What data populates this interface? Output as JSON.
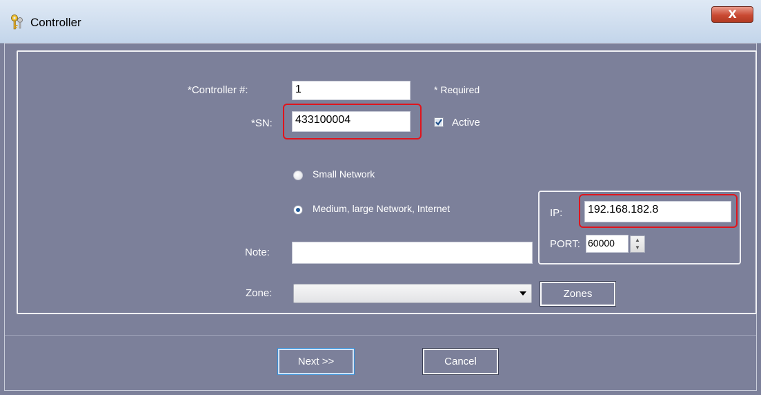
{
  "window": {
    "title": "Controller",
    "close_glyph": "X"
  },
  "form": {
    "controller_no_label": "*Controller #:",
    "controller_no_value": "1",
    "required_note": "* Required",
    "sn_label": "*SN:",
    "sn_value": "433100004",
    "active_label": "Active",
    "active_checked": true,
    "small_network_label": "Small Network",
    "medium_network_label": "Medium, large Network, Internet",
    "selected_network": "Medium, large Network, Internet",
    "ip_label": "IP:",
    "ip_value": "192.168.182.8",
    "port_label": "PORT:",
    "port_value": "60000",
    "note_label": "Note:",
    "note_value": "",
    "zone_label": "Zone:",
    "zone_value": "",
    "zones_button": "Zones"
  },
  "footer": {
    "next_button": "Next >>",
    "cancel_button": "Cancel"
  },
  "colors": {
    "background": "#7c809a",
    "highlight": "#e0141c",
    "close_button": "#c94a33"
  }
}
